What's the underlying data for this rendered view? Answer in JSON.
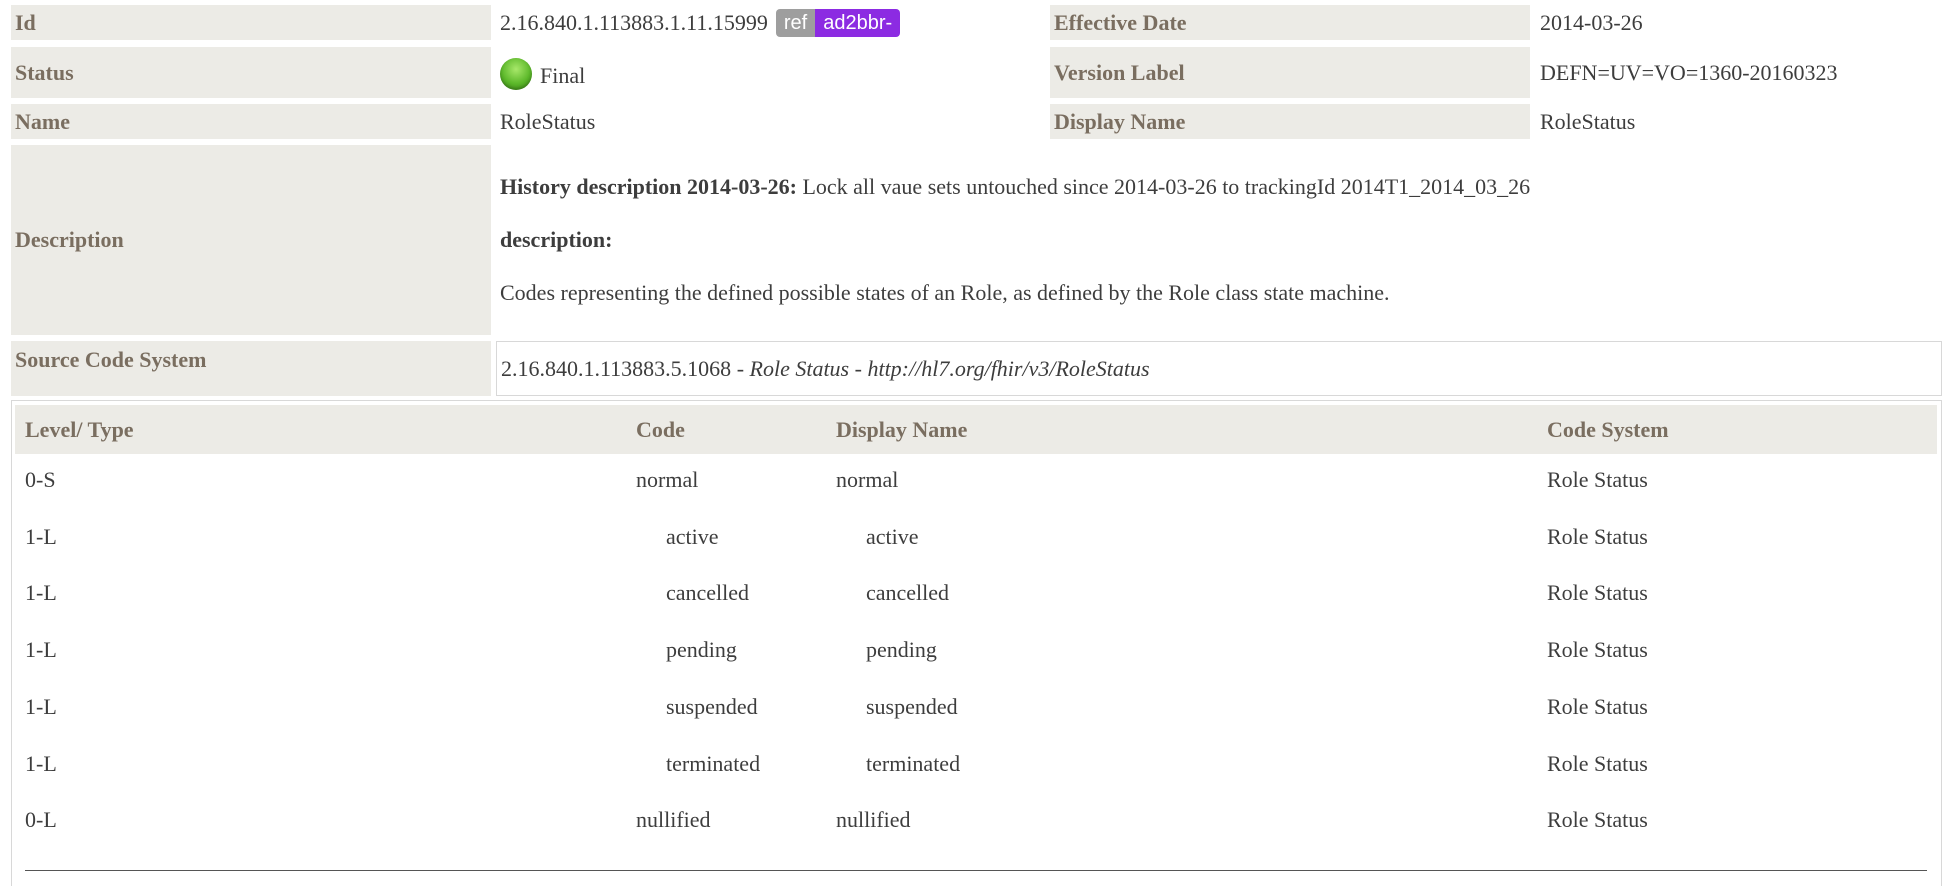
{
  "fields": {
    "id_label": "Id",
    "id_value": "2.16.840.1.113883.1.11.15999",
    "ref_badge": "ref",
    "id_badge": "ad2bbr-",
    "effective_date_label": "Effective Date",
    "effective_date_value": "2014-03-26",
    "status_label": "Status",
    "status_value": "Final",
    "version_label_label": "Version Label",
    "version_label_value": "DEFN=UV=VO=1360-20160323",
    "name_label": "Name",
    "name_value": "RoleStatus",
    "display_name_label": "Display Name",
    "display_name_value": "RoleStatus",
    "description_label": "Description",
    "history_heading": "History description 2014-03-26:",
    "history_text": "Lock all vaue sets untouched since 2014-03-26 to trackingId 2014T1_2014_03_26",
    "description_heading": "description:",
    "description_text": "Codes representing the defined possible states of an Role, as defined by the Role class state machine.",
    "source_code_system_label": "Source Code System",
    "source_oid": "2.16.840.1.113883.5.1068",
    "source_sep1": " - ",
    "source_name": "Role Status",
    "source_sep2": " - ",
    "source_url": "http://hl7.org/fhir/v3/RoleStatus"
  },
  "colors": {
    "label_bg": "#ecebe6",
    "label_text": "#7a6e60",
    "ref_badge": "#9e9e9e",
    "id_badge": "#8c2be2",
    "status_final": "#5cb82a"
  },
  "table": {
    "headers": [
      "Level/ Type",
      "Code",
      "Display Name",
      "Code System"
    ],
    "rows": [
      {
        "level": "0-S",
        "code": "normal",
        "display": "normal",
        "system": "Role Status",
        "indent": false
      },
      {
        "level": "1-L",
        "code": "active",
        "display": "active",
        "system": "Role Status",
        "indent": true
      },
      {
        "level": "1-L",
        "code": "cancelled",
        "display": "cancelled",
        "system": "Role Status",
        "indent": true
      },
      {
        "level": "1-L",
        "code": "pending",
        "display": "pending",
        "system": "Role Status",
        "indent": true
      },
      {
        "level": "1-L",
        "code": "suspended",
        "display": "suspended",
        "system": "Role Status",
        "indent": true
      },
      {
        "level": "1-L",
        "code": "terminated",
        "display": "terminated",
        "system": "Role Status",
        "indent": true
      },
      {
        "level": "0-L",
        "code": "nullified",
        "display": "nullified",
        "system": "Role Status",
        "indent": false
      }
    ]
  }
}
